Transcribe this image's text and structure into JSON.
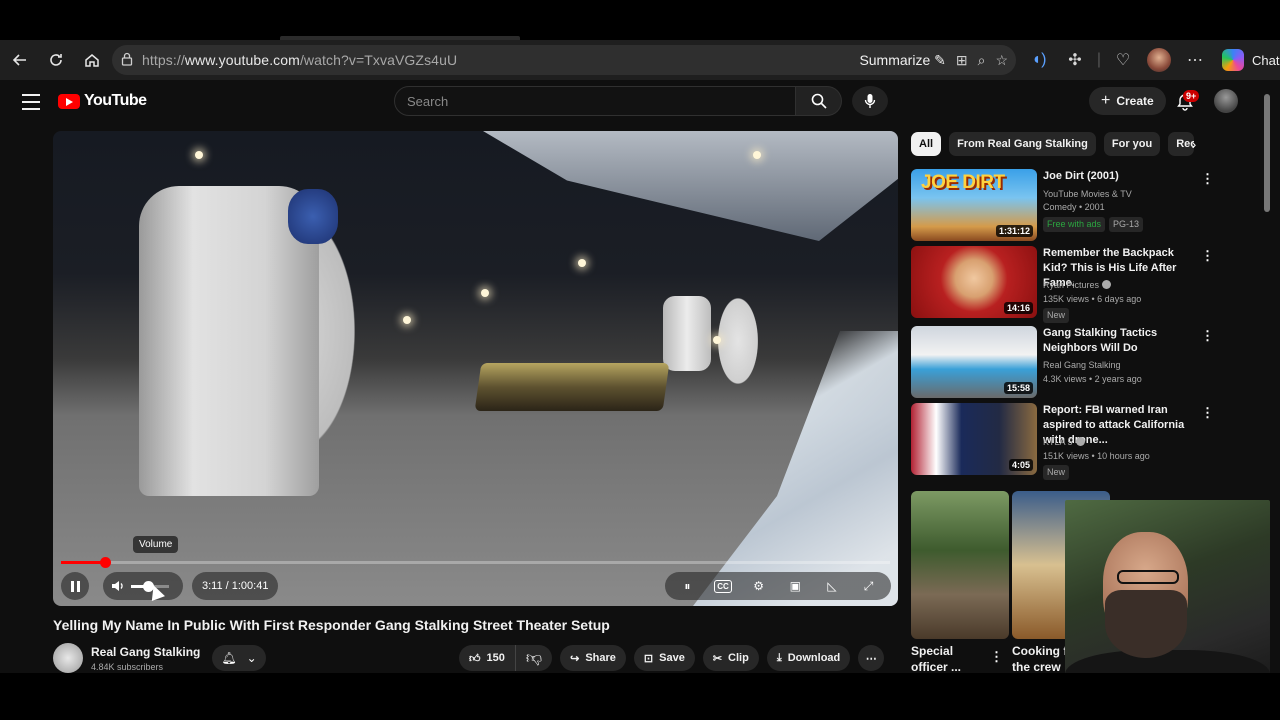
{
  "browser": {
    "url_prefix": "https://",
    "url_host": "www.youtube.com",
    "url_path": "/watch?v=TxvaVGZs4uU",
    "summarize_label": "Summarize",
    "chat_label": "Chat"
  },
  "masthead": {
    "logo_text": "YouTube",
    "search_placeholder": "Search",
    "create_label": "Create",
    "notifications_badge": "9+"
  },
  "player": {
    "volume_tooltip": "Volume",
    "time_display": "3:11 / 1:00:41",
    "progress_fraction": 0.0525,
    "volume_fraction": 0.45
  },
  "video": {
    "title": "Yelling My Name In Public With First Responder Gang Stalking Street Theater Setup",
    "channel_name": "Real Gang Stalking",
    "channel_subs": "4.84K subscribers",
    "like_count": "150",
    "share_label": "Share",
    "save_label": "Save",
    "clip_label": "Clip",
    "download_label": "Download"
  },
  "chips": [
    "All",
    "From Real Gang Stalking",
    "For you",
    "Rec"
  ],
  "recommendations": [
    {
      "title": "Joe Dirt (2001)",
      "meta1": "YouTube Movies & TV",
      "meta2": "Comedy • 2001",
      "tag1": "Free with ads",
      "tag2": "PG-13",
      "duration": "1:31:12",
      "thumb_text": "JOE DIRT"
    },
    {
      "title": "Remember the Backpack Kid? This is His Life After Fame.",
      "meta1": "Ryan Pictures",
      "meta2": "135K views • 6 days ago",
      "tag1": "New",
      "duration": "14:16"
    },
    {
      "title": "Gang Stalking Tactics Neighbors Will Do",
      "meta1": "Real Gang Stalking",
      "meta2": "4.3K views • 2 years ago",
      "duration": "15:58"
    },
    {
      "title": "Report: FBI warned Iran aspired to attack  California with drone...",
      "meta1": "KTLA 5",
      "meta2": "151K views • 10 hours ago",
      "tag1": "New",
      "duration": "4:05"
    }
  ],
  "shorts": [
    {
      "title_line1": "Special",
      "title_line2": "officer ..."
    },
    {
      "title_line1": "Cooking fo",
      "title_line2": "the crew"
    }
  ],
  "colors": {
    "brand_red": "#ff0000",
    "background": "#0f0f0f",
    "chip_active_bg": "#f1f1f1",
    "free_green": "#2ba640"
  }
}
